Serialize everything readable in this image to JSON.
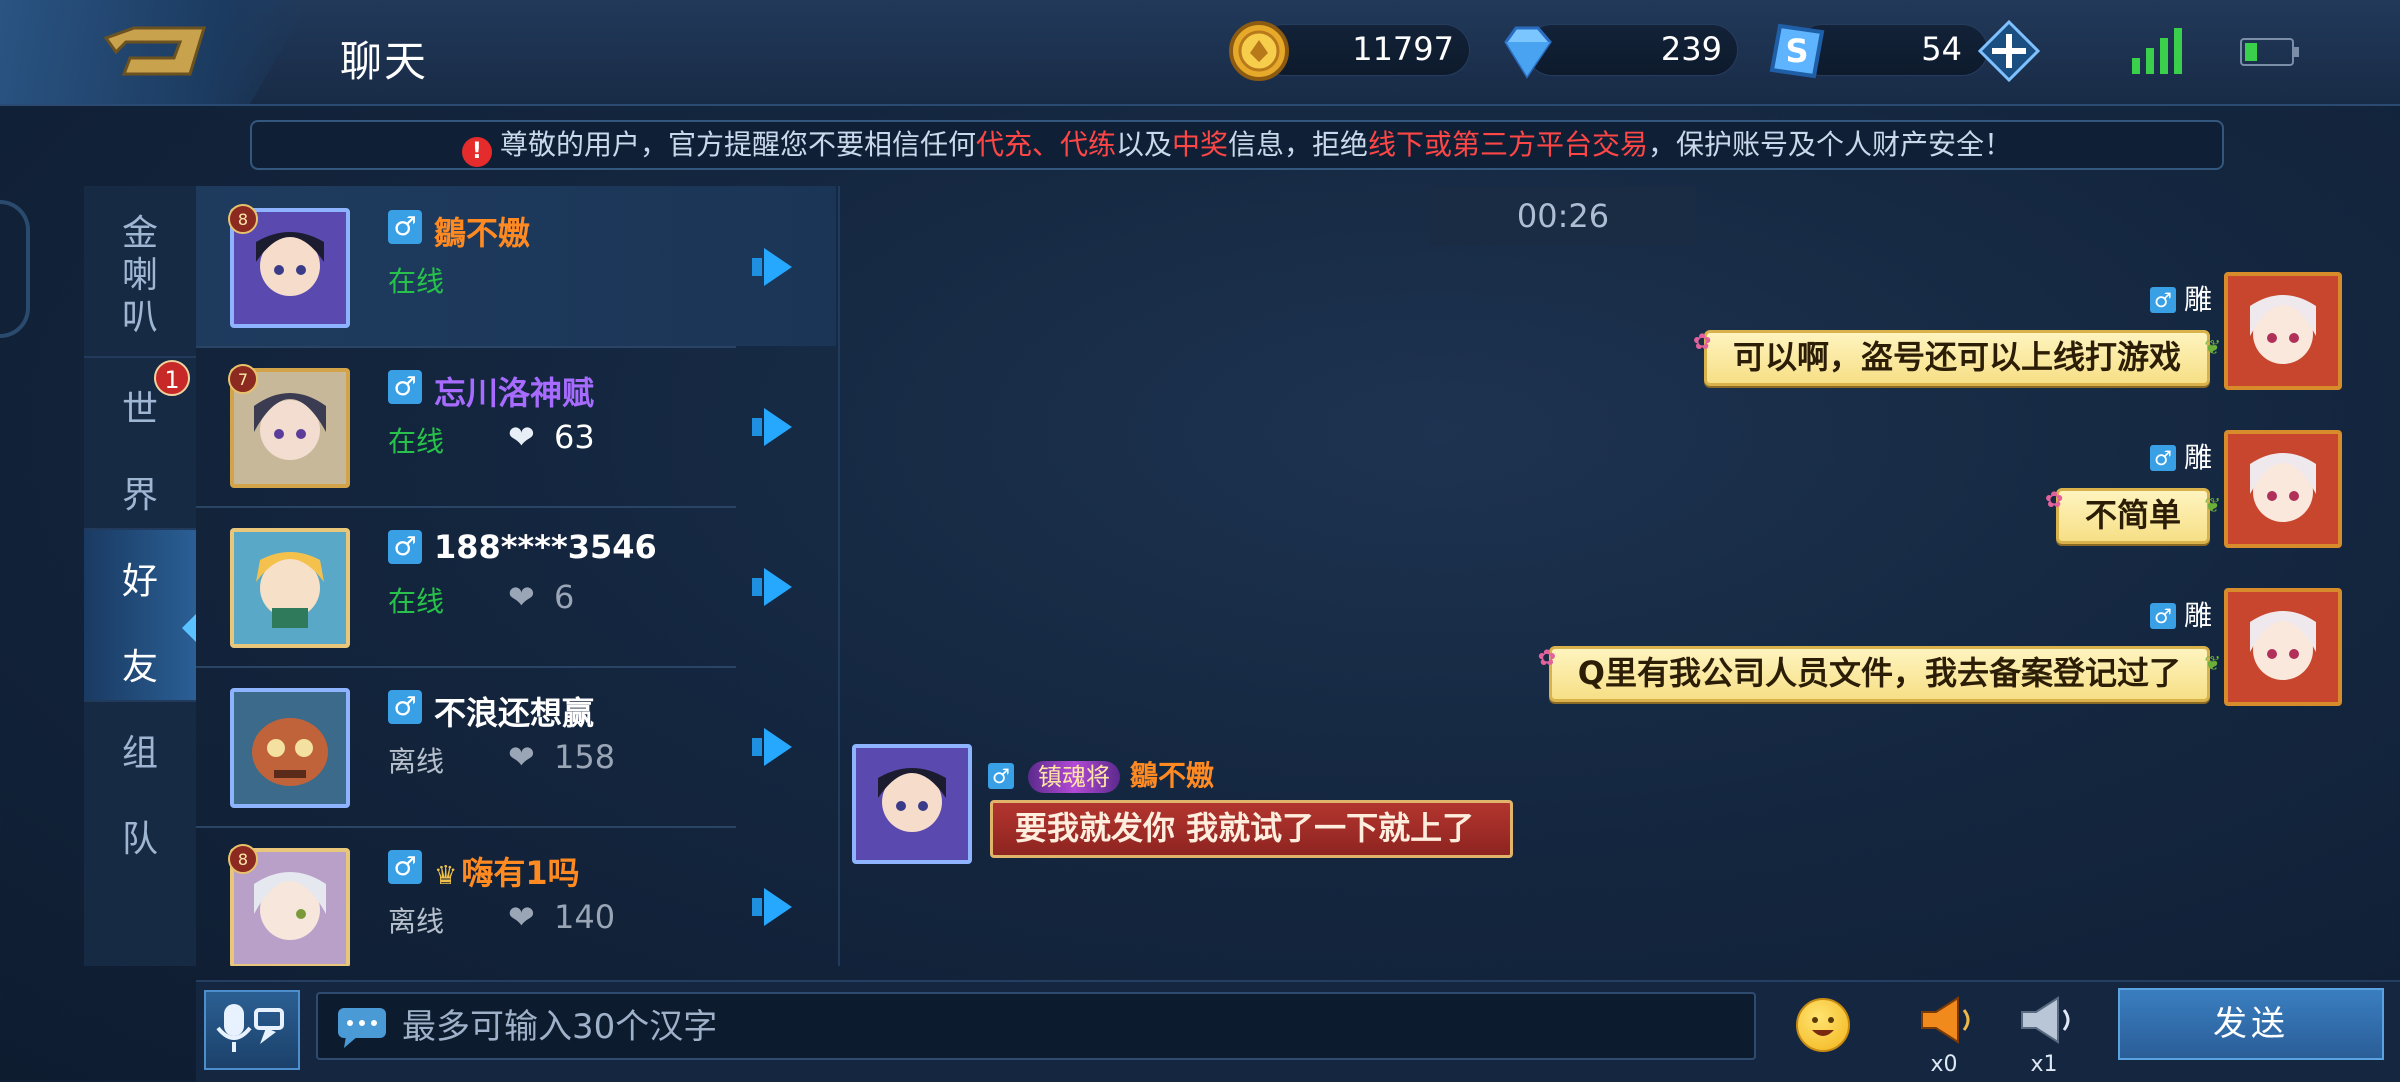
{
  "header": {
    "title": "聊天",
    "gold": "11797",
    "diamonds": "239",
    "vouchers": "54"
  },
  "notice": {
    "p1": "尊敬的用户，官方提醒您不要相信任何",
    "r1": "代充、代练",
    "p2": "以及",
    "r2": "中奖",
    "p3": "信息，拒绝",
    "r3": "线下或第三方平台交易",
    "p4": "，保护账号及个人财产安全！"
  },
  "tabs": [
    {
      "label": [
        "金",
        "喇",
        "叭"
      ]
    },
    {
      "label": [
        "世",
        "界"
      ],
      "badge": "1"
    },
    {
      "label": [
        "好",
        "友"
      ]
    },
    {
      "label": [
        "组",
        "队"
      ]
    }
  ],
  "friends": [
    {
      "level": "8",
      "name": "鶵不嫐",
      "status": "在线",
      "hearts": ""
    },
    {
      "level": "7",
      "name": "忘川洛神赋",
      "status": "在线",
      "hearts": "63"
    },
    {
      "level": "",
      "name": "188****3546",
      "status": "在线",
      "hearts": "6"
    },
    {
      "level": "",
      "name": "不浪还想赢",
      "status": "离线",
      "hearts": "158"
    },
    {
      "level": "8",
      "name": "嗨有1吗",
      "status": "离线",
      "hearts": "140"
    }
  ],
  "chat": {
    "time": "00:26",
    "messages": [
      {
        "side": "right",
        "sender": "雕",
        "text": "可以啊，盗号还可以上线打游戏"
      },
      {
        "side": "right",
        "sender": "雕",
        "text": "不简单"
      },
      {
        "side": "right",
        "sender": "雕",
        "text": "Q里有我公司人员文件，我去备案登记过了"
      },
      {
        "side": "left",
        "sender": "鶵不嫐",
        "title": "镇魂将",
        "text": "要我就发你 我就试了一下就上了"
      }
    ]
  },
  "input": {
    "placeholder": "最多可输入30个汉字",
    "horn_small_count": "x0",
    "horn_big_count": "x1",
    "send_label": "发送"
  },
  "colors": {
    "online": "#27c24a",
    "offline": "#b6c0cc",
    "name_orange": "#ff8a22",
    "name_purple": "#a76cff",
    "warning_red": "#ff4646"
  }
}
